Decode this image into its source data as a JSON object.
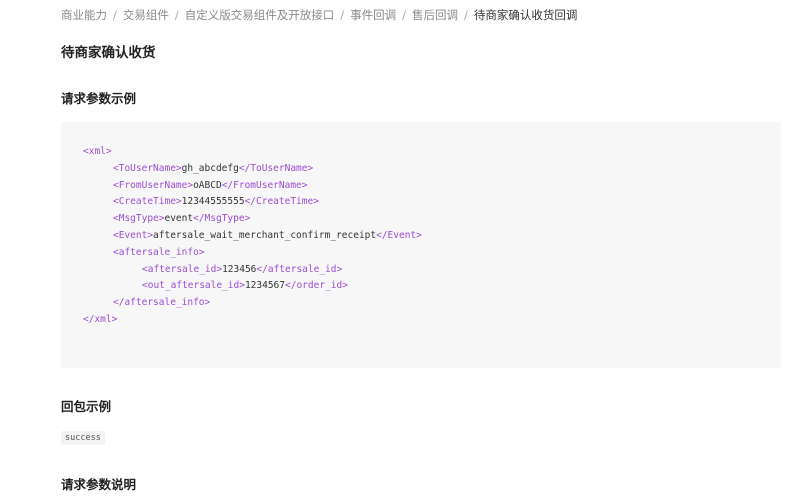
{
  "breadcrumb": {
    "separator": "/",
    "items": [
      "商业能力",
      "交易组件",
      "自定义版交易组件及开放接口",
      "事件回调",
      "售后回调",
      "待商家确认收货回调"
    ]
  },
  "page_title": "待商家确认收货",
  "sections": {
    "request_example_title": "请求参数示例",
    "response_example_title": "回包示例",
    "request_params_title": "请求参数说明"
  },
  "code": {
    "l1_open": "<xml>",
    "l2_open": "<ToUserName>",
    "l2_value": "gh_abcdefg",
    "l2_close": "</ToUserName>",
    "l3_open": "<FromUserName>",
    "l3_value": "oABCD",
    "l3_close": "</FromUserName>",
    "l4_open": "<CreateTime>",
    "l4_value": "12344555555",
    "l4_close": "</CreateTime>",
    "l5_open": "<MsgType>",
    "l5_value": "event",
    "l5_close": "</MsgType>",
    "l6_open": "<Event>",
    "l6_value": "aftersale_wait_merchant_confirm_receipt",
    "l6_close": "</Event>",
    "l7_open": "<aftersale_info>",
    "l8_open": "<aftersale_id>",
    "l8_value": "123456",
    "l8_close": "</aftersale_id>",
    "l9_open": "<out_aftersale_id>",
    "l9_value": "1234567",
    "l9_close": "</order_id>",
    "l10_close": "</aftersale_info>",
    "l11_close": "</xml>"
  },
  "response_example": "success",
  "colors": {
    "tag": "#9b4fd1",
    "code_bg": "#f7f7f7"
  }
}
